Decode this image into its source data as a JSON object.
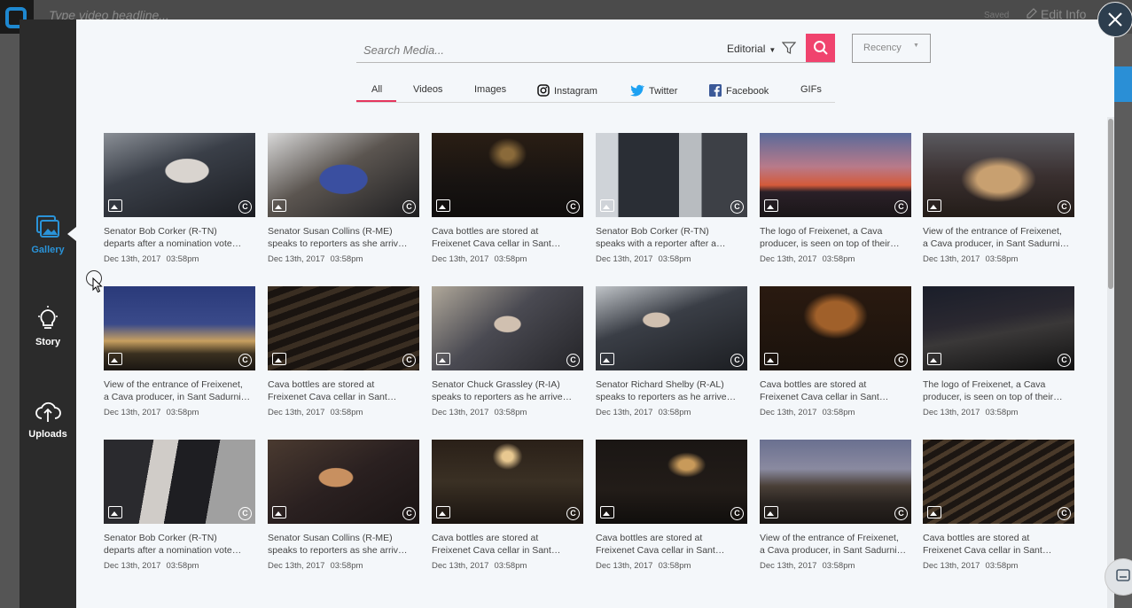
{
  "background": {
    "headline_placeholder": "Type video headline...",
    "saved_label": "Saved",
    "edit_info_label": "Edit Info"
  },
  "sidebar": {
    "items": [
      {
        "label": "Gallery",
        "icon": "gallery-icon",
        "active": true
      },
      {
        "label": "Story",
        "icon": "lightbulb-icon",
        "active": false
      },
      {
        "label": "Uploads",
        "icon": "cloud-upload-icon",
        "active": false
      }
    ]
  },
  "search": {
    "placeholder": "Search Media...",
    "source": "Editorial",
    "sort": "Recency"
  },
  "tabs": [
    {
      "label": "All",
      "active": true
    },
    {
      "label": "Videos"
    },
    {
      "label": "Images"
    },
    {
      "label": "Instagram",
      "icon": "instagram-icon"
    },
    {
      "label": "Twitter",
      "icon": "twitter-icon"
    },
    {
      "label": "Facebook",
      "icon": "facebook-icon"
    },
    {
      "label": "GIFs"
    }
  ],
  "media": [
    {
      "line1": "Senator Bob Corker (R-TN)",
      "line2": "departs after a nomination vote…",
      "date": "Dec 13th, 2017",
      "time": "03:58pm"
    },
    {
      "line1": "Senator Susan Collins (R-ME)",
      "line2": "speaks to reporters as she arriv…",
      "date": "Dec 13th, 2017",
      "time": "03:58pm"
    },
    {
      "line1": "Cava bottles are stored at",
      "line2": "Freixenet Cava cellar in Sant…",
      "date": "Dec 13th, 2017",
      "time": "03:58pm"
    },
    {
      "line1": "Senator Bob Corker (R-TN)",
      "line2": "speaks with a reporter after a…",
      "date": "Dec 13th, 2017",
      "time": "03:58pm"
    },
    {
      "line1": "The logo of Freixenet, a Cava",
      "line2": "producer, is seen on top of their…",
      "date": "Dec 13th, 2017",
      "time": "03:58pm"
    },
    {
      "line1": "View of the entrance of Freixenet,",
      "line2": "a Cava producer, in Sant Sadurni…",
      "date": "Dec 13th, 2017",
      "time": "03:58pm"
    },
    {
      "line1": "View of the entrance of Freixenet,",
      "line2": "a Cava producer, in Sant Sadurni…",
      "date": "Dec 13th, 2017",
      "time": "03:58pm"
    },
    {
      "line1": "Cava bottles are stored at",
      "line2": "Freixenet Cava cellar in Sant…",
      "date": "Dec 13th, 2017",
      "time": "03:58pm"
    },
    {
      "line1": "Senator Chuck Grassley (R-IA)",
      "line2": "speaks to reporters as he arrive…",
      "date": "Dec 13th, 2017",
      "time": "03:58pm"
    },
    {
      "line1": "Senator Richard Shelby (R-AL)",
      "line2": "speaks to reporters as he arrive…",
      "date": "Dec 13th, 2017",
      "time": "03:58pm"
    },
    {
      "line1": "Cava bottles are stored at",
      "line2": "Freixenet Cava cellar in Sant…",
      "date": "Dec 13th, 2017",
      "time": "03:58pm"
    },
    {
      "line1": "The logo of Freixenet, a Cava",
      "line2": "producer, is seen on top of their…",
      "date": "Dec 13th, 2017",
      "time": "03:58pm"
    },
    {
      "line1": "Senator Bob Corker (R-TN)",
      "line2": "departs after a nomination vote…",
      "date": "Dec 13th, 2017",
      "time": "03:58pm"
    },
    {
      "line1": "Senator Susan Collins (R-ME)",
      "line2": "speaks to reporters as she arriv…",
      "date": "Dec 13th, 2017",
      "time": "03:58pm"
    },
    {
      "line1": "Cava bottles are stored at",
      "line2": "Freixenet Cava cellar in Sant…",
      "date": "Dec 13th, 2017",
      "time": "03:58pm"
    },
    {
      "line1": "Cava bottles are stored at",
      "line2": "Freixenet Cava cellar in Sant…",
      "date": "Dec 13th, 2017",
      "time": "03:58pm"
    },
    {
      "line1": "View of the entrance of Freixenet,",
      "line2": "a Cava producer, in Sant Sadurni…",
      "date": "Dec 13th, 2017",
      "time": "03:58pm"
    },
    {
      "line1": "Cava bottles are stored at",
      "line2": "Freixenet Cava cellar in Sant…",
      "date": "Dec 13th, 2017",
      "time": "03:58pm"
    }
  ],
  "colors": {
    "accent": "#e5365e",
    "search_button": "#f0436e",
    "gallery_active": "#2a93d8",
    "sidebar_bg": "#2b2b2b",
    "panel_bg": "#f4f7fa"
  }
}
